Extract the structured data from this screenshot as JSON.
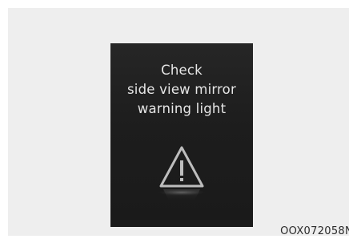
{
  "warning_message": {
    "line1": "Check",
    "line2": "side view mirror",
    "line3": "warning light"
  },
  "icon": "warning-triangle-icon",
  "figure_code": "OOX072058N"
}
